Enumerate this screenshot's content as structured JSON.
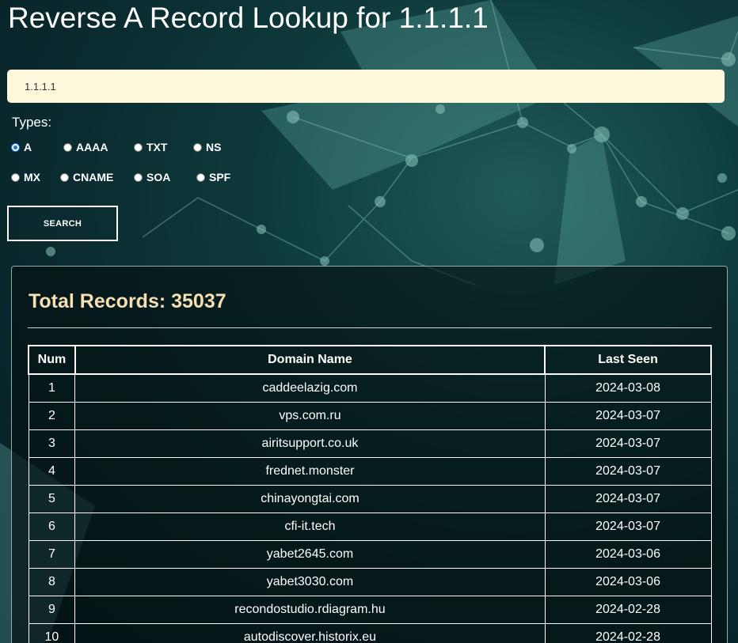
{
  "title": "Reverse A Record Lookup for 1.1.1.1",
  "search": {
    "value": "1.1.1.1",
    "button_label": "SEARCH"
  },
  "types": {
    "label": "Types:",
    "options": [
      "A",
      "AAAA",
      "TXT",
      "NS",
      "MX",
      "CNAME",
      "SOA",
      "SPF"
    ],
    "selected": "A"
  },
  "results": {
    "total_text": "Total Records: 35037",
    "columns": [
      "Num",
      "Domain Name",
      "Last Seen"
    ],
    "rows": [
      {
        "num": "1",
        "domain": "caddeelazig.com",
        "last_seen": "2024-03-08"
      },
      {
        "num": "2",
        "domain": "vps.com.ru",
        "last_seen": "2024-03-07"
      },
      {
        "num": "3",
        "domain": "airitsupport.co.uk",
        "last_seen": "2024-03-07"
      },
      {
        "num": "4",
        "domain": "frednet.monster",
        "last_seen": "2024-03-07"
      },
      {
        "num": "5",
        "domain": "chinayongtai.com",
        "last_seen": "2024-03-07"
      },
      {
        "num": "6",
        "domain": "cfi-it.tech",
        "last_seen": "2024-03-07"
      },
      {
        "num": "7",
        "domain": "yabet2645.com",
        "last_seen": "2024-03-06"
      },
      {
        "num": "8",
        "domain": "yabet3030.com",
        "last_seen": "2024-03-06"
      },
      {
        "num": "9",
        "domain": "recondostudio.rdiagram.hu",
        "last_seen": "2024-02-28"
      },
      {
        "num": "10",
        "domain": "autodiscover.historix.eu",
        "last_seen": "2024-02-28"
      }
    ]
  },
  "colors": {
    "background": "#0e3a3b",
    "input_bg": "#fef8dc",
    "total_text": "#f7dfb2",
    "radio_accent": "#1a73e8"
  }
}
